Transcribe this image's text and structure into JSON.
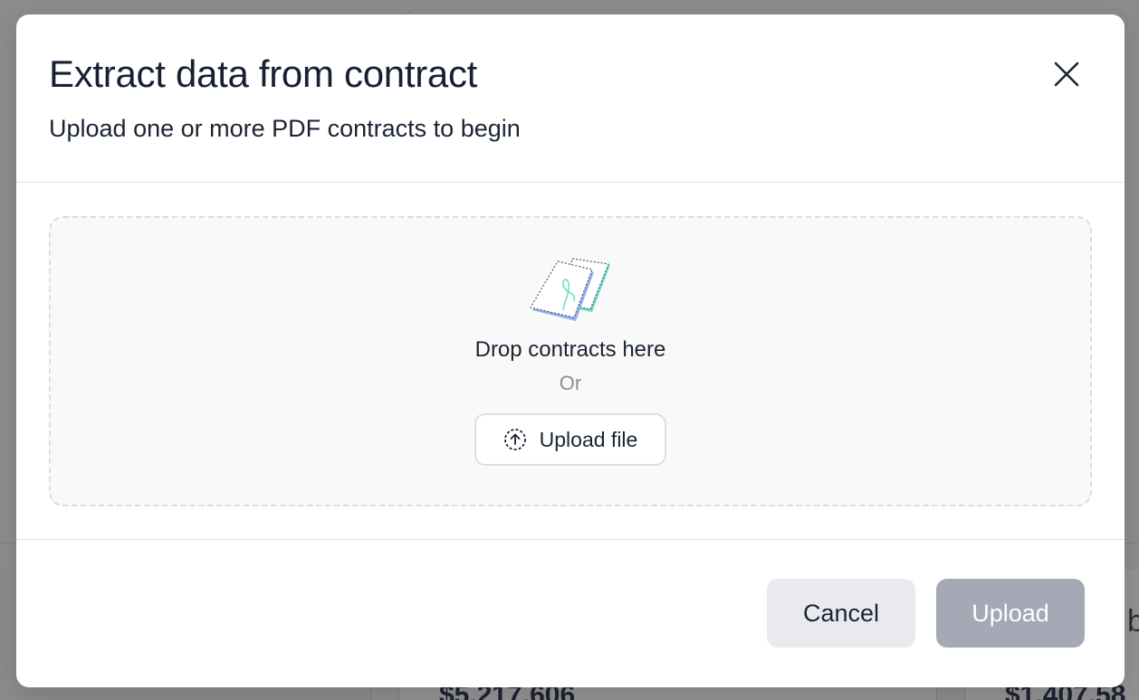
{
  "background": {
    "values": [
      "$5,217,606",
      "$1,407,58"
    ],
    "partial_letter": "b"
  },
  "modal": {
    "title": "Extract data from contract",
    "subtitle": "Upload one or more PDF contracts to begin",
    "close_icon": "close-icon"
  },
  "dropzone": {
    "icon": "documents-illustration",
    "title": "Drop contracts here",
    "or_text": "Or",
    "upload_button": {
      "icon": "upload-circle-icon",
      "label": "Upload file"
    }
  },
  "footer": {
    "cancel_label": "Cancel",
    "upload_label": "Upload",
    "upload_disabled": true
  },
  "colors": {
    "overlay": "#8a8a8b",
    "primary_disabled": "#a5a9b6",
    "secondary": "#e9eaee",
    "text": "#1b2433",
    "muted": "#8a8f98"
  }
}
